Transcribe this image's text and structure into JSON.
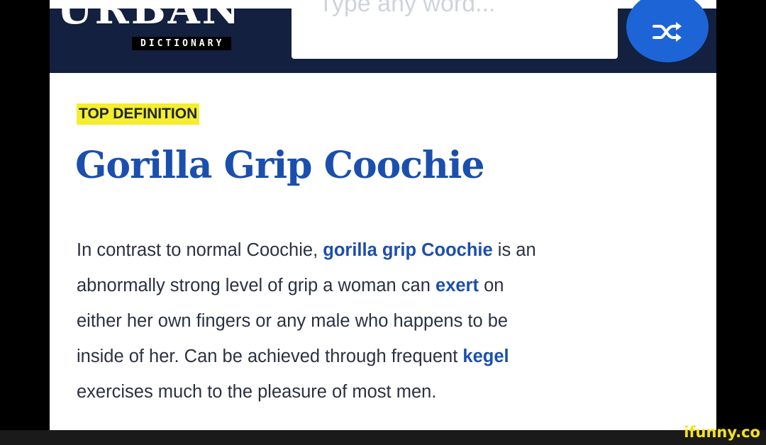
{
  "header": {
    "logo_word": "URBAN",
    "logo_sub": "DICTIONARY",
    "search_placeholder": "Type any word..."
  },
  "entry": {
    "badge": "TOP DEFINITION",
    "word": "Gorilla Grip Coochie",
    "meaning": {
      "l1a": "In contrast to normal Coochie, ",
      "l1b": "gorilla grip Coochie",
      "l1c": " is an",
      "l2a": "abnormally strong level of grip a woman can ",
      "l2b": "exert",
      "l2c": " on",
      "l3": "either her own fingers or any male who happens to be",
      "l4a": "inside of her. Can be achieved through frequent ",
      "l4b": "kegel",
      "l5": "exercises much to the pleasure of most men."
    }
  },
  "watermark": "ifunny.co",
  "colors": {
    "header_bg": "#13203f",
    "accent_blue": "#1b4fae",
    "shuffle_blue": "#1d64d6",
    "highlight": "#f4ee2e",
    "watermark": "#f5e21b"
  },
  "icons": {
    "shuffle": "shuffle-icon"
  }
}
